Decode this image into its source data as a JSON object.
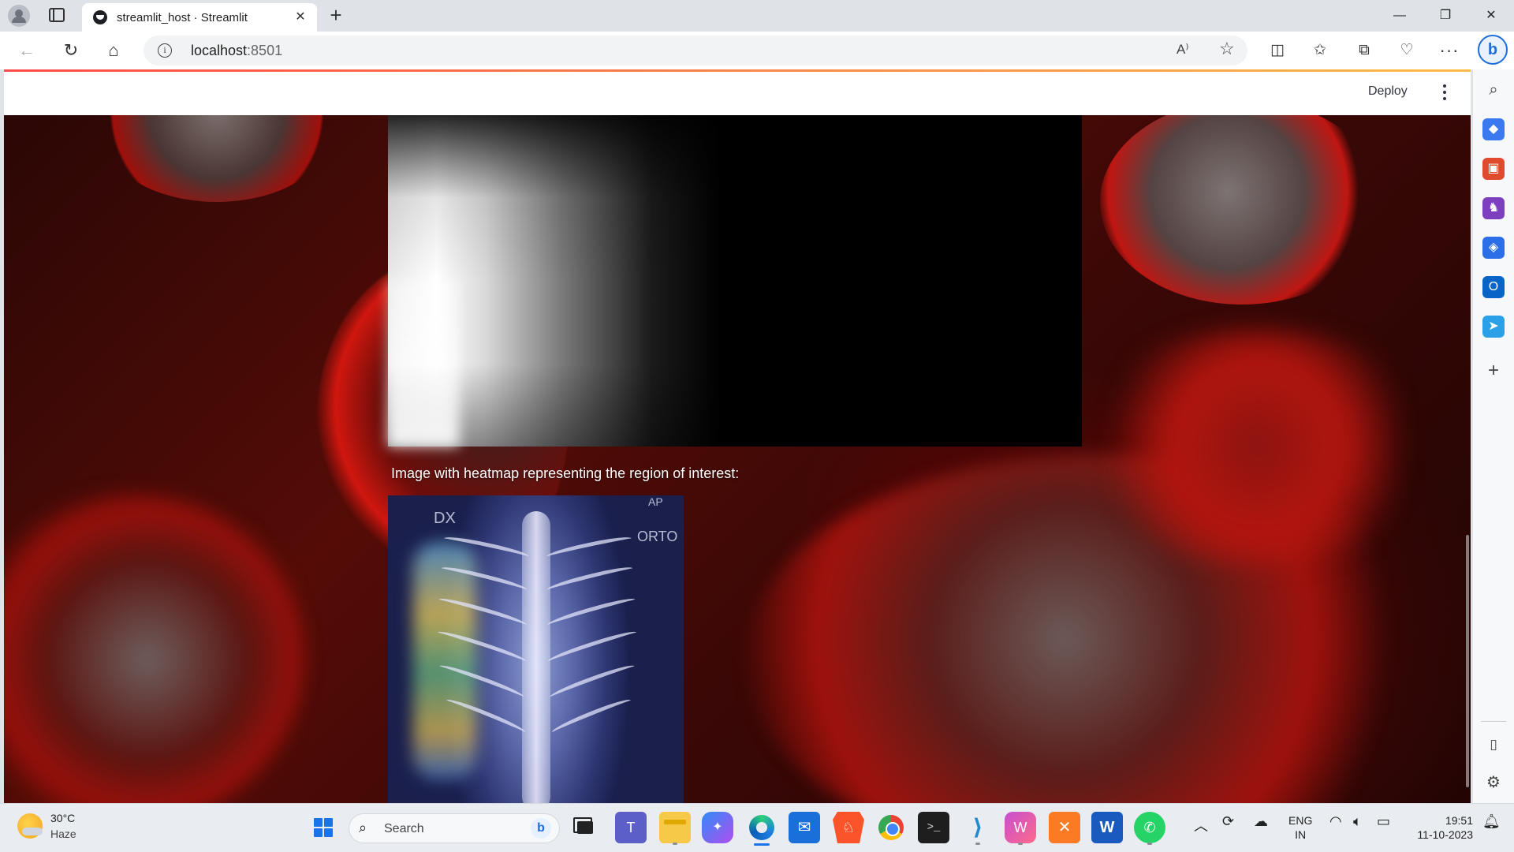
{
  "browser": {
    "tab_title": "streamlit_host · Streamlit",
    "tab_close_glyph": "✕",
    "new_tab_glyph": "+",
    "url_host": "localhost",
    "url_port": ":8501",
    "window_controls": {
      "minimize": "—",
      "maximize": "❐",
      "close": "✕"
    }
  },
  "streamlit": {
    "deploy_label": "Deploy",
    "caption": "Image with heatmap representing the region of interest:",
    "xray_markers": {
      "dx": "DX",
      "orto": "ORTO",
      "ap": "AP"
    },
    "accent_colors": [
      "#ff4b4b",
      "#ffbd45"
    ]
  },
  "taskbar": {
    "weather": {
      "temp": "30°C",
      "condition": "Haze"
    },
    "search_placeholder": "Search",
    "language": {
      "line1": "ENG",
      "line2": "IN"
    },
    "clock": {
      "time": "19:51",
      "date": "11-10-2023"
    },
    "apps": [
      "start",
      "search",
      "task-view",
      "teams",
      "file-explorer",
      "copilot",
      "edge",
      "mail",
      "brave",
      "chrome",
      "terminal",
      "vscode",
      "wps",
      "xampp",
      "word",
      "whatsapp"
    ]
  },
  "icons": {
    "profile": "profile-icon",
    "tab_actions": "tab-actions-icon",
    "back": "back-arrow-icon",
    "reload": "reload-icon",
    "home": "home-icon",
    "info": "info-icon",
    "read_aloud": "read-aloud-icon",
    "favorite": "star-icon",
    "split_screen": "split-screen-icon",
    "favorites": "favorites-icon",
    "collections": "collections-icon",
    "browser_essentials": "heart-pulse-icon",
    "more": "more-icon",
    "copilot": "bing-copilot-icon"
  }
}
